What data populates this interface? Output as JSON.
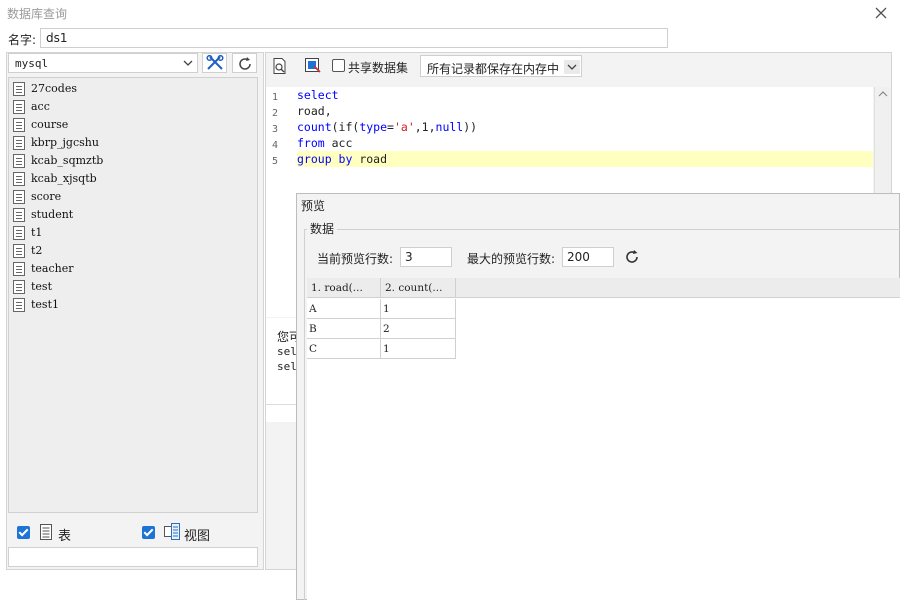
{
  "window": {
    "title": "数据库查询"
  },
  "name_row": {
    "label": "名字:",
    "value": "ds1"
  },
  "left_panel": {
    "db_select": "mysql",
    "tables": [
      "27codes",
      "acc",
      "course",
      "kbrp_jgcshu",
      "kcab_sqmztb",
      "kcab_xjsqtb",
      "score",
      "student",
      "t1",
      "t2",
      "teacher",
      "test",
      "test1"
    ],
    "show_tables_label": "表",
    "show_views_label": "视图"
  },
  "toolbar": {
    "shared_label": "共享数据集",
    "mode_value": "所有记录都保存在内存中"
  },
  "editor": {
    "line_numbers": [
      "1",
      "2",
      "3",
      "4",
      "5"
    ],
    "line1": "select",
    "line2": "road,",
    "line3_fn": "count",
    "line3_p1": "(if(",
    "line3_kw1": "type",
    "line3_eq": "=",
    "line3_str": "'a'",
    "line3_mid": ",1,",
    "line3_kw2": "null",
    "line3_end": "))",
    "line4_kw": "from",
    "line4_rest": " acc",
    "line5_kw": "group by",
    "line5_rest": " road"
  },
  "hint": {
    "line1": "您可",
    "line2": "sele",
    "line3": "sele"
  },
  "preview": {
    "title": "预览",
    "group_label": "数据",
    "current_rows_label": "当前预览行数:",
    "current_rows_value": "3",
    "max_rows_label": "最大的预览行数:",
    "max_rows_value": "200",
    "columns": [
      "1. road(...",
      "2. count(..."
    ],
    "rows": [
      [
        "A",
        "1"
      ],
      [
        "B",
        "2"
      ],
      [
        "C",
        "1"
      ]
    ]
  }
}
